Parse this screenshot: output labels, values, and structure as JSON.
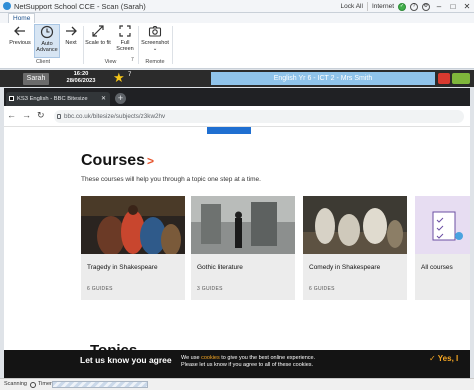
{
  "window": {
    "title": "NetSupport School CCE  -  Scan (Sarah)",
    "lock_all": "Lock All",
    "internet": "Internet"
  },
  "ribbon": {
    "tab": "Home",
    "buttons": {
      "previous": "Previous",
      "auto_advance_line1": "Auto",
      "auto_advance_line2": "Advance",
      "next": "Next",
      "scale_to_fit": "Scale to fit",
      "full_screen_line1": "Full",
      "full_screen_line2": "Screen",
      "screenshot": "Screenshot"
    },
    "groups": {
      "client": "Client",
      "view": "View",
      "remote": "Remote"
    },
    "counter": "7"
  },
  "student_strip": {
    "name": "Sarah",
    "time": "16:20",
    "date": "28/06/2023",
    "star_count": "7",
    "lesson": "English Yr 6 - ICT 2 - Mrs Smith"
  },
  "browser": {
    "tab_title": "KS3 English - BBC Bitesize",
    "url": "bbc.co.uk/bitesize/subjects/z3kw2hv"
  },
  "page": {
    "title": "Courses",
    "title_chevron": ">",
    "subtitle": "These courses will help you through a topic one step at a time.",
    "courses": [
      {
        "title": "Tragedy in Shakespeare",
        "guides": "6 GUIDES"
      },
      {
        "title": "Gothic literature",
        "guides": "3 GUIDES"
      },
      {
        "title": "Comedy in Shakespeare",
        "guides": "6 GUIDES"
      },
      {
        "title": "All courses",
        "guides": ""
      }
    ],
    "topics": "Topics",
    "cookie_title": "Let us know you agree",
    "cookie_text_1": "We use",
    "cookie_link": "cookies",
    "cookie_text_2": "to give you the best online experience.",
    "cookie_text_3": "Please let us know if you agree to all of these cookies.",
    "cookie_button": "Yes, I"
  },
  "status_bar": {
    "scanning": "Scanning",
    "timer": "Timer"
  }
}
